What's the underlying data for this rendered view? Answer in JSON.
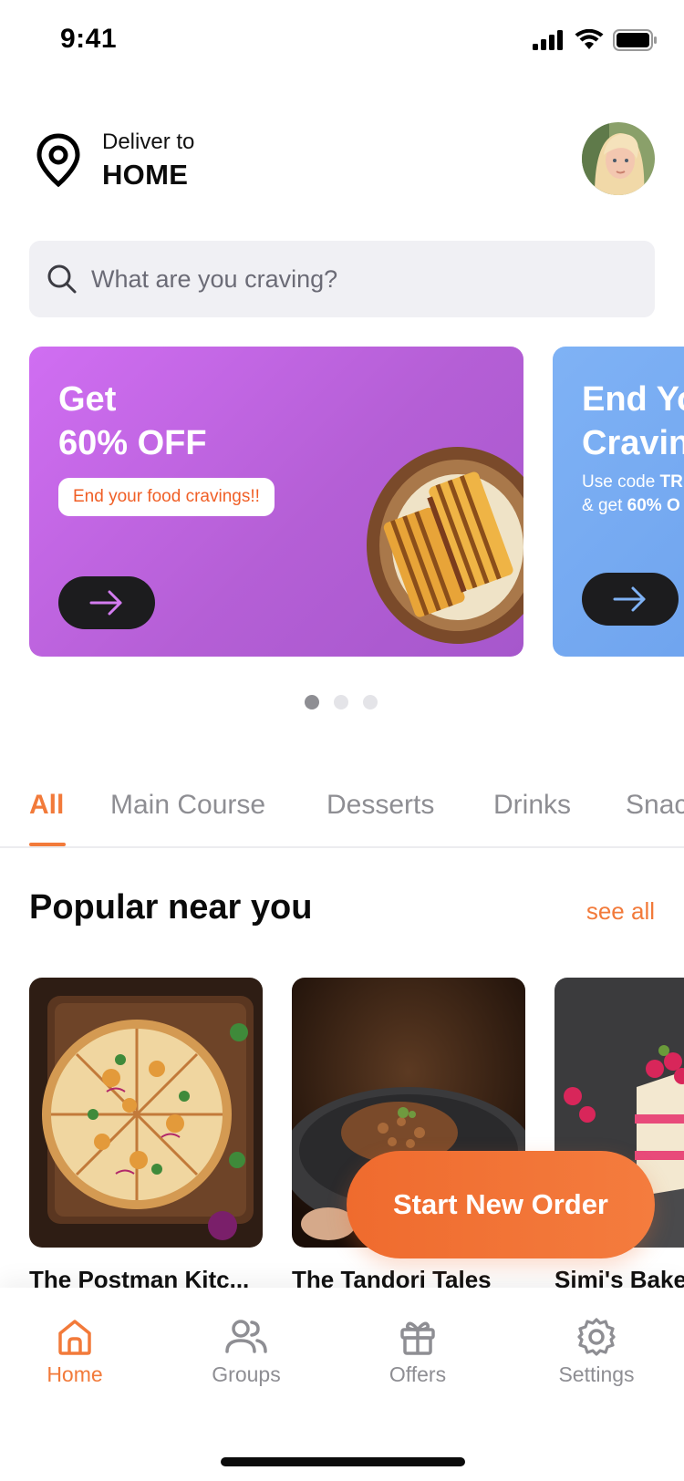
{
  "status_bar": {
    "time": "9:41"
  },
  "header": {
    "deliver_label": "Deliver to",
    "deliver_value": "HOME"
  },
  "search": {
    "placeholder": "What are you craving?"
  },
  "promos": [
    {
      "title_line1": "Get",
      "title_line2": "60% OFF",
      "pill": "End your food cravings!!",
      "color": "#c064e8"
    },
    {
      "title_line1": "End Yo",
      "title_line2": "Cravin",
      "sub_line1_pre": "Use code ",
      "sub_line1_bold": "TR",
      "sub_line2_pre": "& get ",
      "sub_line2_bold": "60% O",
      "color": "#7faef3"
    }
  ],
  "carousel": {
    "page_count": 3,
    "active_index": 0
  },
  "tabs": [
    {
      "label": "All",
      "active": true
    },
    {
      "label": "Main Course"
    },
    {
      "label": "Desserts"
    },
    {
      "label": "Drinks"
    },
    {
      "label": "Snac"
    }
  ],
  "popular": {
    "title": "Popular near you",
    "see_all": "see all",
    "items": [
      {
        "name": "The Postman Kitc..."
      },
      {
        "name": "The Tandori Tales"
      },
      {
        "name": "Simi's Bake"
      }
    ]
  },
  "cta": {
    "label": "Start New Order"
  },
  "bottom_nav": {
    "items": [
      {
        "label": "Home",
        "icon": "home-icon",
        "active": true
      },
      {
        "label": "Groups",
        "icon": "groups-icon"
      },
      {
        "label": "Offers",
        "icon": "gift-icon"
      },
      {
        "label": "Settings",
        "icon": "settings-icon"
      }
    ]
  },
  "colors": {
    "accent": "#f27a3a",
    "cta": "#ef6b2e"
  }
}
